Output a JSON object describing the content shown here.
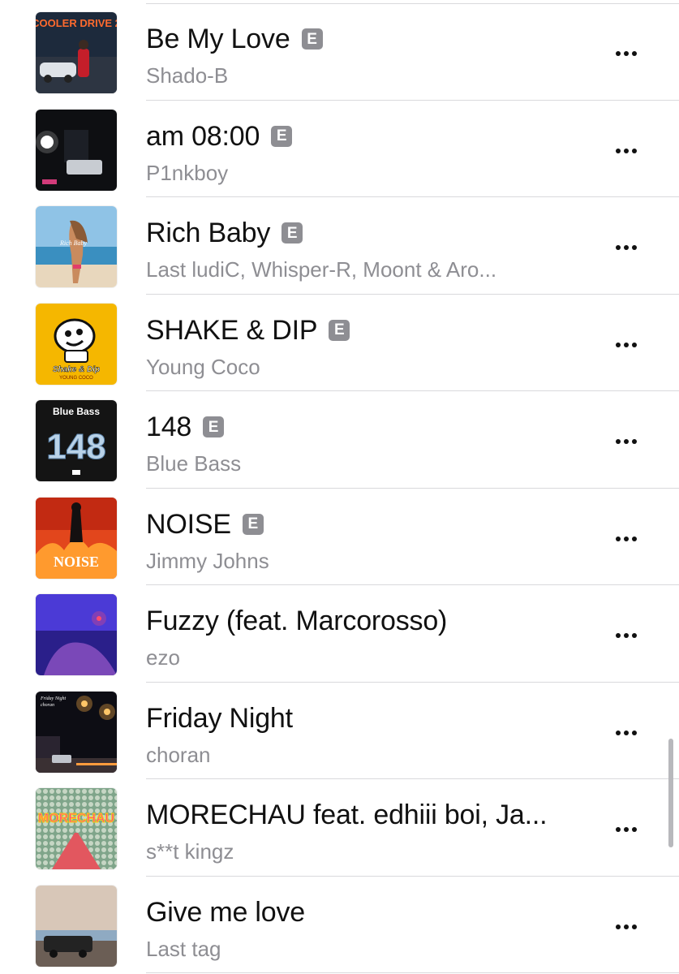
{
  "songs": [
    {
      "title": "Be My Love",
      "artist": "Shado-B",
      "explicit": true,
      "explicit_label": "E",
      "art": "cooler-drive-art"
    },
    {
      "title": "am 08:00",
      "artist": "P1nkboy",
      "explicit": true,
      "explicit_label": "E",
      "art": "night-car-art"
    },
    {
      "title": "Rich Baby",
      "artist": "Last ludiC, Whisper-R, Moont & Aro...",
      "explicit": true,
      "explicit_label": "E",
      "art": "beach-art"
    },
    {
      "title": "SHAKE & DIP",
      "artist": "Young Coco",
      "explicit": true,
      "explicit_label": "E",
      "art": "yellow-cartoon-art"
    },
    {
      "title": "148",
      "artist": "Blue Bass",
      "explicit": true,
      "explicit_label": "E",
      "art": "blue-bass-art"
    },
    {
      "title": "NOISE",
      "artist": "Jimmy Johns",
      "explicit": true,
      "explicit_label": "E",
      "art": "fire-art"
    },
    {
      "title": "Fuzzy (feat. Marcorosso)",
      "artist": "ezo",
      "explicit": false,
      "explicit_label": "",
      "art": "purple-art"
    },
    {
      "title": "Friday Night",
      "artist": "choran",
      "explicit": false,
      "explicit_label": "",
      "art": "night-street-art"
    },
    {
      "title": "MORECHAU feat. edhiii boi, Ja...",
      "artist": "s**t kingz",
      "explicit": false,
      "explicit_label": "",
      "art": "morechau-art"
    },
    {
      "title": "Give me love",
      "artist": "Last tag",
      "explicit": false,
      "explicit_label": "",
      "art": "sunset-car-art"
    }
  ],
  "artwork_text": {
    "cooler_drive": "COOLER DRIVE 2",
    "rich_baby": "Rich Baby",
    "shake_dip": "Shake & Dip",
    "young_coco": "YOUNG COCO",
    "blue_bass": "Blue Bass",
    "number": "148",
    "noise": "NOISE",
    "friday_night": "Friday Night",
    "choran": "choran",
    "morechau": "MORECHAU"
  },
  "colors": {
    "explicit_badge": "#8e8e93",
    "subtitle": "#8e8e93",
    "divider": "#d9d9dc"
  }
}
